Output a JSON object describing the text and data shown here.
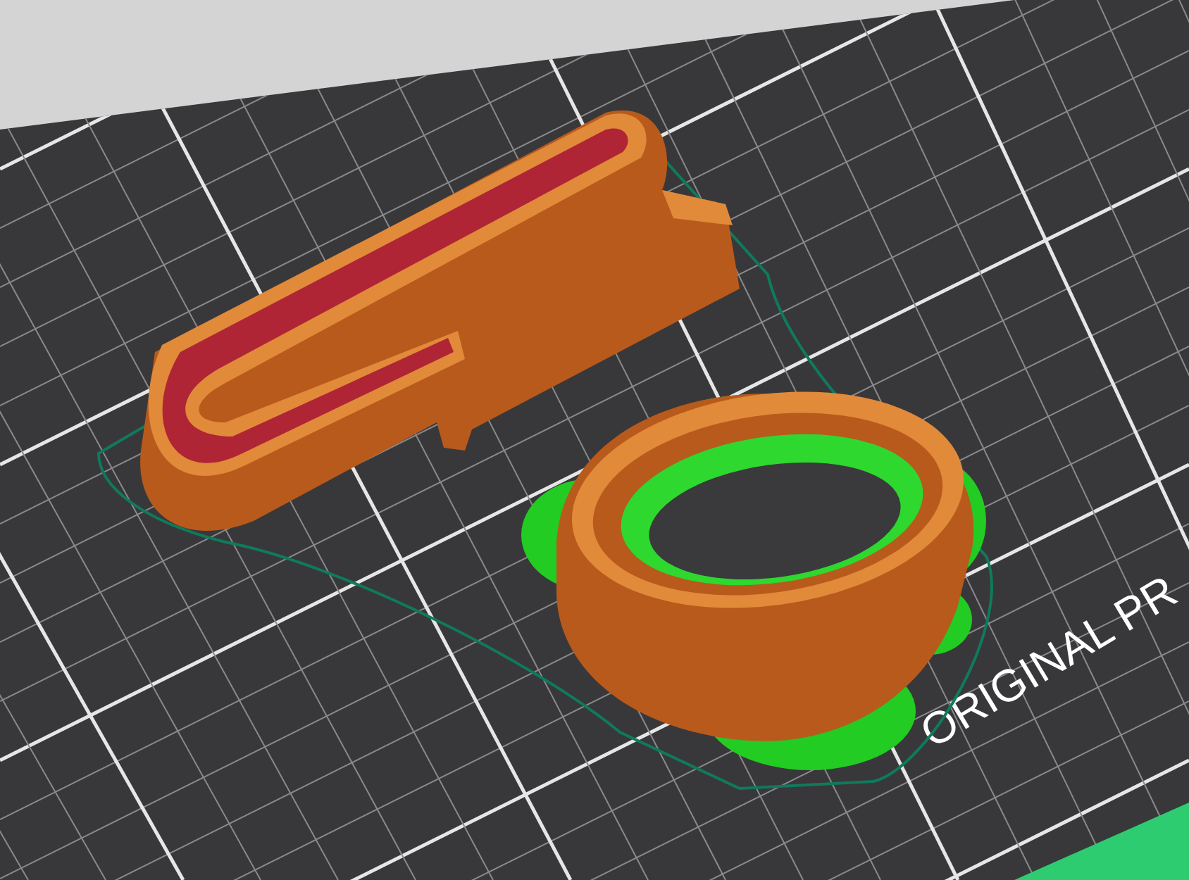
{
  "bed_label": "ORIGINAL PR"
}
